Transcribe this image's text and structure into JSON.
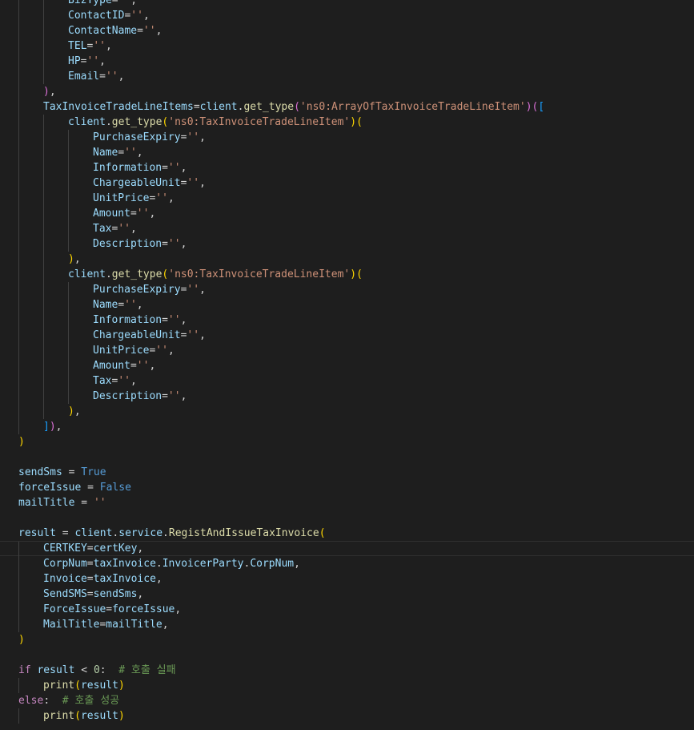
{
  "editor": {
    "theme": "dark",
    "colors": {
      "background": "#1e1e1e",
      "variable": "#9cdcfe",
      "function": "#dcdcaa",
      "string": "#ce9178",
      "operator": "#d4d4d4",
      "keyword_constant": "#569cd6",
      "keyword_control": "#c586c0",
      "number": "#b5cea8",
      "comment": "#6a9955",
      "bracket_level_1": "#ffd700",
      "bracket_level_2": "#da70d6",
      "bracket_level_3": "#179fff"
    },
    "lines": [
      {
        "indent": 2,
        "tokens": [
          [
            "var",
            "BizType"
          ],
          [
            "op",
            "="
          ],
          [
            "str",
            "''"
          ],
          [
            "op",
            ","
          ]
        ]
      },
      {
        "indent": 2,
        "tokens": [
          [
            "var",
            "ContactID"
          ],
          [
            "op",
            "="
          ],
          [
            "str",
            "''"
          ],
          [
            "op",
            ","
          ]
        ]
      },
      {
        "indent": 2,
        "tokens": [
          [
            "var",
            "ContactName"
          ],
          [
            "op",
            "="
          ],
          [
            "str",
            "''"
          ],
          [
            "op",
            ","
          ]
        ]
      },
      {
        "indent": 2,
        "tokens": [
          [
            "var",
            "TEL"
          ],
          [
            "op",
            "="
          ],
          [
            "str",
            "''"
          ],
          [
            "op",
            ","
          ]
        ]
      },
      {
        "indent": 2,
        "tokens": [
          [
            "var",
            "HP"
          ],
          [
            "op",
            "="
          ],
          [
            "str",
            "''"
          ],
          [
            "op",
            ","
          ]
        ]
      },
      {
        "indent": 2,
        "tokens": [
          [
            "var",
            "Email"
          ],
          [
            "op",
            "="
          ],
          [
            "str",
            "''"
          ],
          [
            "op",
            ","
          ]
        ]
      },
      {
        "indent": 1,
        "tokens": [
          [
            "b2",
            ")"
          ],
          [
            "op",
            ","
          ]
        ]
      },
      {
        "indent": 1,
        "tokens": [
          [
            "var",
            "TaxInvoiceTradeLineItems"
          ],
          [
            "op",
            "="
          ],
          [
            "var",
            "client"
          ],
          [
            "op",
            "."
          ],
          [
            "fn",
            "get_type"
          ],
          [
            "b2",
            "("
          ],
          [
            "str",
            "'ns0:ArrayOfTaxInvoiceTradeLineItem'"
          ],
          [
            "b2",
            ")"
          ],
          [
            "b2",
            "("
          ],
          [
            "b3",
            "["
          ]
        ]
      },
      {
        "indent": 2,
        "tokens": [
          [
            "var",
            "client"
          ],
          [
            "op",
            "."
          ],
          [
            "fn",
            "get_type"
          ],
          [
            "b1",
            "("
          ],
          [
            "str",
            "'ns0:TaxInvoiceTradeLineItem'"
          ],
          [
            "b1",
            ")"
          ],
          [
            "b1",
            "("
          ]
        ]
      },
      {
        "indent": 3,
        "tokens": [
          [
            "var",
            "PurchaseExpiry"
          ],
          [
            "op",
            "="
          ],
          [
            "str",
            "''"
          ],
          [
            "op",
            ","
          ]
        ]
      },
      {
        "indent": 3,
        "tokens": [
          [
            "var",
            "Name"
          ],
          [
            "op",
            "="
          ],
          [
            "str",
            "''"
          ],
          [
            "op",
            ","
          ]
        ]
      },
      {
        "indent": 3,
        "tokens": [
          [
            "var",
            "Information"
          ],
          [
            "op",
            "="
          ],
          [
            "str",
            "''"
          ],
          [
            "op",
            ","
          ]
        ]
      },
      {
        "indent": 3,
        "tokens": [
          [
            "var",
            "ChargeableUnit"
          ],
          [
            "op",
            "="
          ],
          [
            "str",
            "''"
          ],
          [
            "op",
            ","
          ]
        ]
      },
      {
        "indent": 3,
        "tokens": [
          [
            "var",
            "UnitPrice"
          ],
          [
            "op",
            "="
          ],
          [
            "str",
            "''"
          ],
          [
            "op",
            ","
          ]
        ]
      },
      {
        "indent": 3,
        "tokens": [
          [
            "var",
            "Amount"
          ],
          [
            "op",
            "="
          ],
          [
            "str",
            "''"
          ],
          [
            "op",
            ","
          ]
        ]
      },
      {
        "indent": 3,
        "tokens": [
          [
            "var",
            "Tax"
          ],
          [
            "op",
            "="
          ],
          [
            "str",
            "''"
          ],
          [
            "op",
            ","
          ]
        ]
      },
      {
        "indent": 3,
        "tokens": [
          [
            "var",
            "Description"
          ],
          [
            "op",
            "="
          ],
          [
            "str",
            "''"
          ],
          [
            "op",
            ","
          ]
        ]
      },
      {
        "indent": 2,
        "tokens": [
          [
            "b1",
            ")"
          ],
          [
            "op",
            ","
          ]
        ]
      },
      {
        "indent": 2,
        "tokens": [
          [
            "var",
            "client"
          ],
          [
            "op",
            "."
          ],
          [
            "fn",
            "get_type"
          ],
          [
            "b1",
            "("
          ],
          [
            "str",
            "'ns0:TaxInvoiceTradeLineItem'"
          ],
          [
            "b1",
            ")"
          ],
          [
            "b1",
            "("
          ]
        ]
      },
      {
        "indent": 3,
        "tokens": [
          [
            "var",
            "PurchaseExpiry"
          ],
          [
            "op",
            "="
          ],
          [
            "str",
            "''"
          ],
          [
            "op",
            ","
          ]
        ]
      },
      {
        "indent": 3,
        "tokens": [
          [
            "var",
            "Name"
          ],
          [
            "op",
            "="
          ],
          [
            "str",
            "''"
          ],
          [
            "op",
            ","
          ]
        ]
      },
      {
        "indent": 3,
        "tokens": [
          [
            "var",
            "Information"
          ],
          [
            "op",
            "="
          ],
          [
            "str",
            "''"
          ],
          [
            "op",
            ","
          ]
        ]
      },
      {
        "indent": 3,
        "tokens": [
          [
            "var",
            "ChargeableUnit"
          ],
          [
            "op",
            "="
          ],
          [
            "str",
            "''"
          ],
          [
            "op",
            ","
          ]
        ]
      },
      {
        "indent": 3,
        "tokens": [
          [
            "var",
            "UnitPrice"
          ],
          [
            "op",
            "="
          ],
          [
            "str",
            "''"
          ],
          [
            "op",
            ","
          ]
        ]
      },
      {
        "indent": 3,
        "tokens": [
          [
            "var",
            "Amount"
          ],
          [
            "op",
            "="
          ],
          [
            "str",
            "''"
          ],
          [
            "op",
            ","
          ]
        ]
      },
      {
        "indent": 3,
        "tokens": [
          [
            "var",
            "Tax"
          ],
          [
            "op",
            "="
          ],
          [
            "str",
            "''"
          ],
          [
            "op",
            ","
          ]
        ]
      },
      {
        "indent": 3,
        "tokens": [
          [
            "var",
            "Description"
          ],
          [
            "op",
            "="
          ],
          [
            "str",
            "''"
          ],
          [
            "op",
            ","
          ]
        ]
      },
      {
        "indent": 2,
        "tokens": [
          [
            "b1",
            ")"
          ],
          [
            "op",
            ","
          ]
        ]
      },
      {
        "indent": 1,
        "tokens": [
          [
            "b3",
            "]"
          ],
          [
            "b2",
            ")"
          ],
          [
            "op",
            ","
          ]
        ]
      },
      {
        "indent": 0,
        "tokens": [
          [
            "b1",
            ")"
          ]
        ]
      },
      {
        "indent": 0,
        "tokens": []
      },
      {
        "indent": 0,
        "tokens": [
          [
            "var",
            "sendSms"
          ],
          [
            "op",
            " = "
          ],
          [
            "kw",
            "True"
          ]
        ]
      },
      {
        "indent": 0,
        "tokens": [
          [
            "var",
            "forceIssue"
          ],
          [
            "op",
            " = "
          ],
          [
            "kw",
            "False"
          ]
        ]
      },
      {
        "indent": 0,
        "tokens": [
          [
            "var",
            "mailTitle"
          ],
          [
            "op",
            " = "
          ],
          [
            "str",
            "''"
          ]
        ]
      },
      {
        "indent": 0,
        "tokens": []
      },
      {
        "indent": 0,
        "tokens": [
          [
            "var",
            "result"
          ],
          [
            "op",
            " = "
          ],
          [
            "var",
            "client"
          ],
          [
            "op",
            "."
          ],
          [
            "var",
            "service"
          ],
          [
            "op",
            "."
          ],
          [
            "fn",
            "RegistAndIssueTaxInvoice"
          ],
          [
            "b1",
            "("
          ]
        ]
      },
      {
        "indent": 1,
        "highlight": true,
        "tokens": [
          [
            "var",
            "CERTKEY"
          ],
          [
            "op",
            "="
          ],
          [
            "var",
            "certKey"
          ],
          [
            "op",
            ","
          ]
        ]
      },
      {
        "indent": 1,
        "tokens": [
          [
            "var",
            "CorpNum"
          ],
          [
            "op",
            "="
          ],
          [
            "var",
            "taxInvoice"
          ],
          [
            "op",
            "."
          ],
          [
            "var",
            "InvoicerParty"
          ],
          [
            "op",
            "."
          ],
          [
            "var",
            "CorpNum"
          ],
          [
            "op",
            ","
          ]
        ]
      },
      {
        "indent": 1,
        "tokens": [
          [
            "var",
            "Invoice"
          ],
          [
            "op",
            "="
          ],
          [
            "var",
            "taxInvoice"
          ],
          [
            "op",
            ","
          ]
        ]
      },
      {
        "indent": 1,
        "tokens": [
          [
            "var",
            "SendSMS"
          ],
          [
            "op",
            "="
          ],
          [
            "var",
            "sendSms"
          ],
          [
            "op",
            ","
          ]
        ]
      },
      {
        "indent": 1,
        "tokens": [
          [
            "var",
            "ForceIssue"
          ],
          [
            "op",
            "="
          ],
          [
            "var",
            "forceIssue"
          ],
          [
            "op",
            ","
          ]
        ]
      },
      {
        "indent": 1,
        "tokens": [
          [
            "var",
            "MailTitle"
          ],
          [
            "op",
            "="
          ],
          [
            "var",
            "mailTitle"
          ],
          [
            "op",
            ","
          ]
        ]
      },
      {
        "indent": 0,
        "tokens": [
          [
            "b1",
            ")"
          ]
        ]
      },
      {
        "indent": 0,
        "tokens": []
      },
      {
        "indent": 0,
        "tokens": [
          [
            "ctl",
            "if"
          ],
          [
            "op",
            " "
          ],
          [
            "var",
            "result"
          ],
          [
            "op",
            " < "
          ],
          [
            "num",
            "0"
          ],
          [
            "op",
            ":  "
          ],
          [
            "com",
            "# 호출 실패"
          ]
        ]
      },
      {
        "indent": 1,
        "tokens": [
          [
            "fn",
            "print"
          ],
          [
            "b1",
            "("
          ],
          [
            "var",
            "result"
          ],
          [
            "b1",
            ")"
          ]
        ]
      },
      {
        "indent": 0,
        "tokens": [
          [
            "ctl",
            "else"
          ],
          [
            "op",
            ":  "
          ],
          [
            "com",
            "# 호출 성공"
          ]
        ]
      },
      {
        "indent": 1,
        "tokens": [
          [
            "fn",
            "print"
          ],
          [
            "b1",
            "("
          ],
          [
            "var",
            "result"
          ],
          [
            "b1",
            ")"
          ]
        ]
      }
    ]
  }
}
